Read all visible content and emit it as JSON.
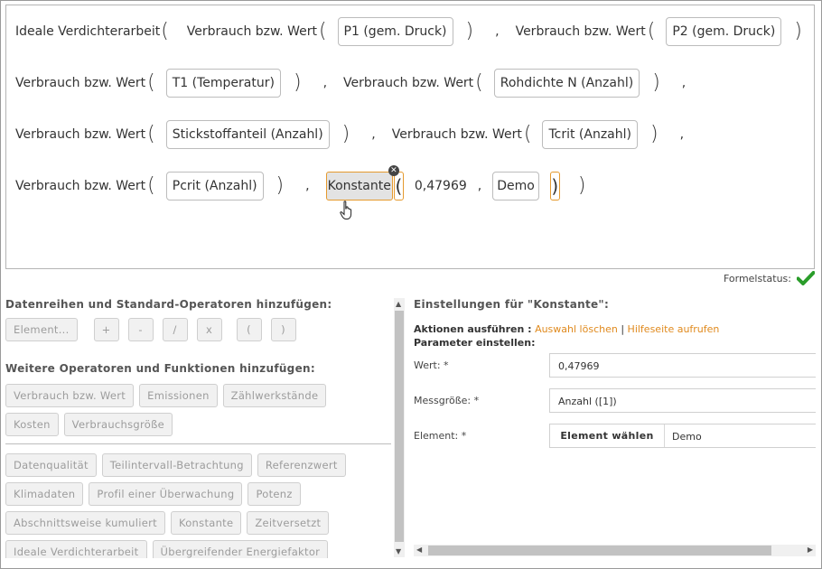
{
  "formula": {
    "row1": {
      "func": "Ideale Verdichterarbeit",
      "vbw1": "Verbrauch bzw. Wert",
      "p1": "P1 (gem. Druck)",
      "vbw2": "Verbrauch bzw. Wert",
      "p2": "P2 (gem. Druck)"
    },
    "row2": {
      "vbw1": "Verbrauch bzw. Wert",
      "t1": "T1 (Temperatur)",
      "vbw2": "Verbrauch bzw. Wert",
      "rho": "Rohdichte N (Anzahl)"
    },
    "row3": {
      "vbw1": "Verbrauch bzw. Wert",
      "n2": "Stickstoffanteil (Anzahl)",
      "vbw2": "Verbrauch bzw. Wert",
      "tcrit": "Tcrit (Anzahl)"
    },
    "row4": {
      "vbw1": "Verbrauch bzw. Wert",
      "pcrit": "Pcrit (Anzahl)",
      "konst": "Konstante",
      "value": "0,47969",
      "element": "Demo"
    },
    "open_paren": "(",
    "close_paren": ")",
    "comma": ","
  },
  "status": {
    "label": "Formelstatus:",
    "state": "ok",
    "color": "#2a9d2a"
  },
  "left": {
    "section1_title": "Datenreihen und Standard-Operatoren hinzufügen:",
    "element_button": "Element...",
    "operators": [
      "+",
      "-",
      "/",
      "x",
      "(",
      ")"
    ],
    "section2_title": "Weitere Operatoren und Funktionen hinzufügen:",
    "group1": [
      "Verbrauch bzw. Wert",
      "Emissionen",
      "Zählwerkstände",
      "Kosten",
      "Verbrauchsgröße"
    ],
    "group2": [
      "Datenqualität",
      "Teilintervall-Betrachtung",
      "Referenzwert",
      "Klimadaten",
      "Profil einer Überwachung",
      "Potenz",
      "Abschnittsweise kumuliert",
      "Konstante",
      "Zeitversetzt",
      "Ideale Verdichterarbeit",
      "Übergreifender Energiefaktor"
    ]
  },
  "right": {
    "title": "Einstellungen für \"Konstante\":",
    "actions_label": "Aktionen ausführen :",
    "action_delete": "Auswahl löschen",
    "separator": "|",
    "action_help": "Hilfeseite aufrufen",
    "params_label": "Parameter einstellen:",
    "fields": {
      "wert_label": "Wert: *",
      "wert_value": "0,47969",
      "mess_label": "Messgröße: *",
      "mess_value": "Anzahl ([1])",
      "elem_label": "Element: *",
      "elem_button": "Element wählen",
      "elem_value": "Demo"
    }
  },
  "colors": {
    "accent": "#e08a1e",
    "selection_border": "#e59a2e",
    "ok": "#2a9d2a"
  }
}
